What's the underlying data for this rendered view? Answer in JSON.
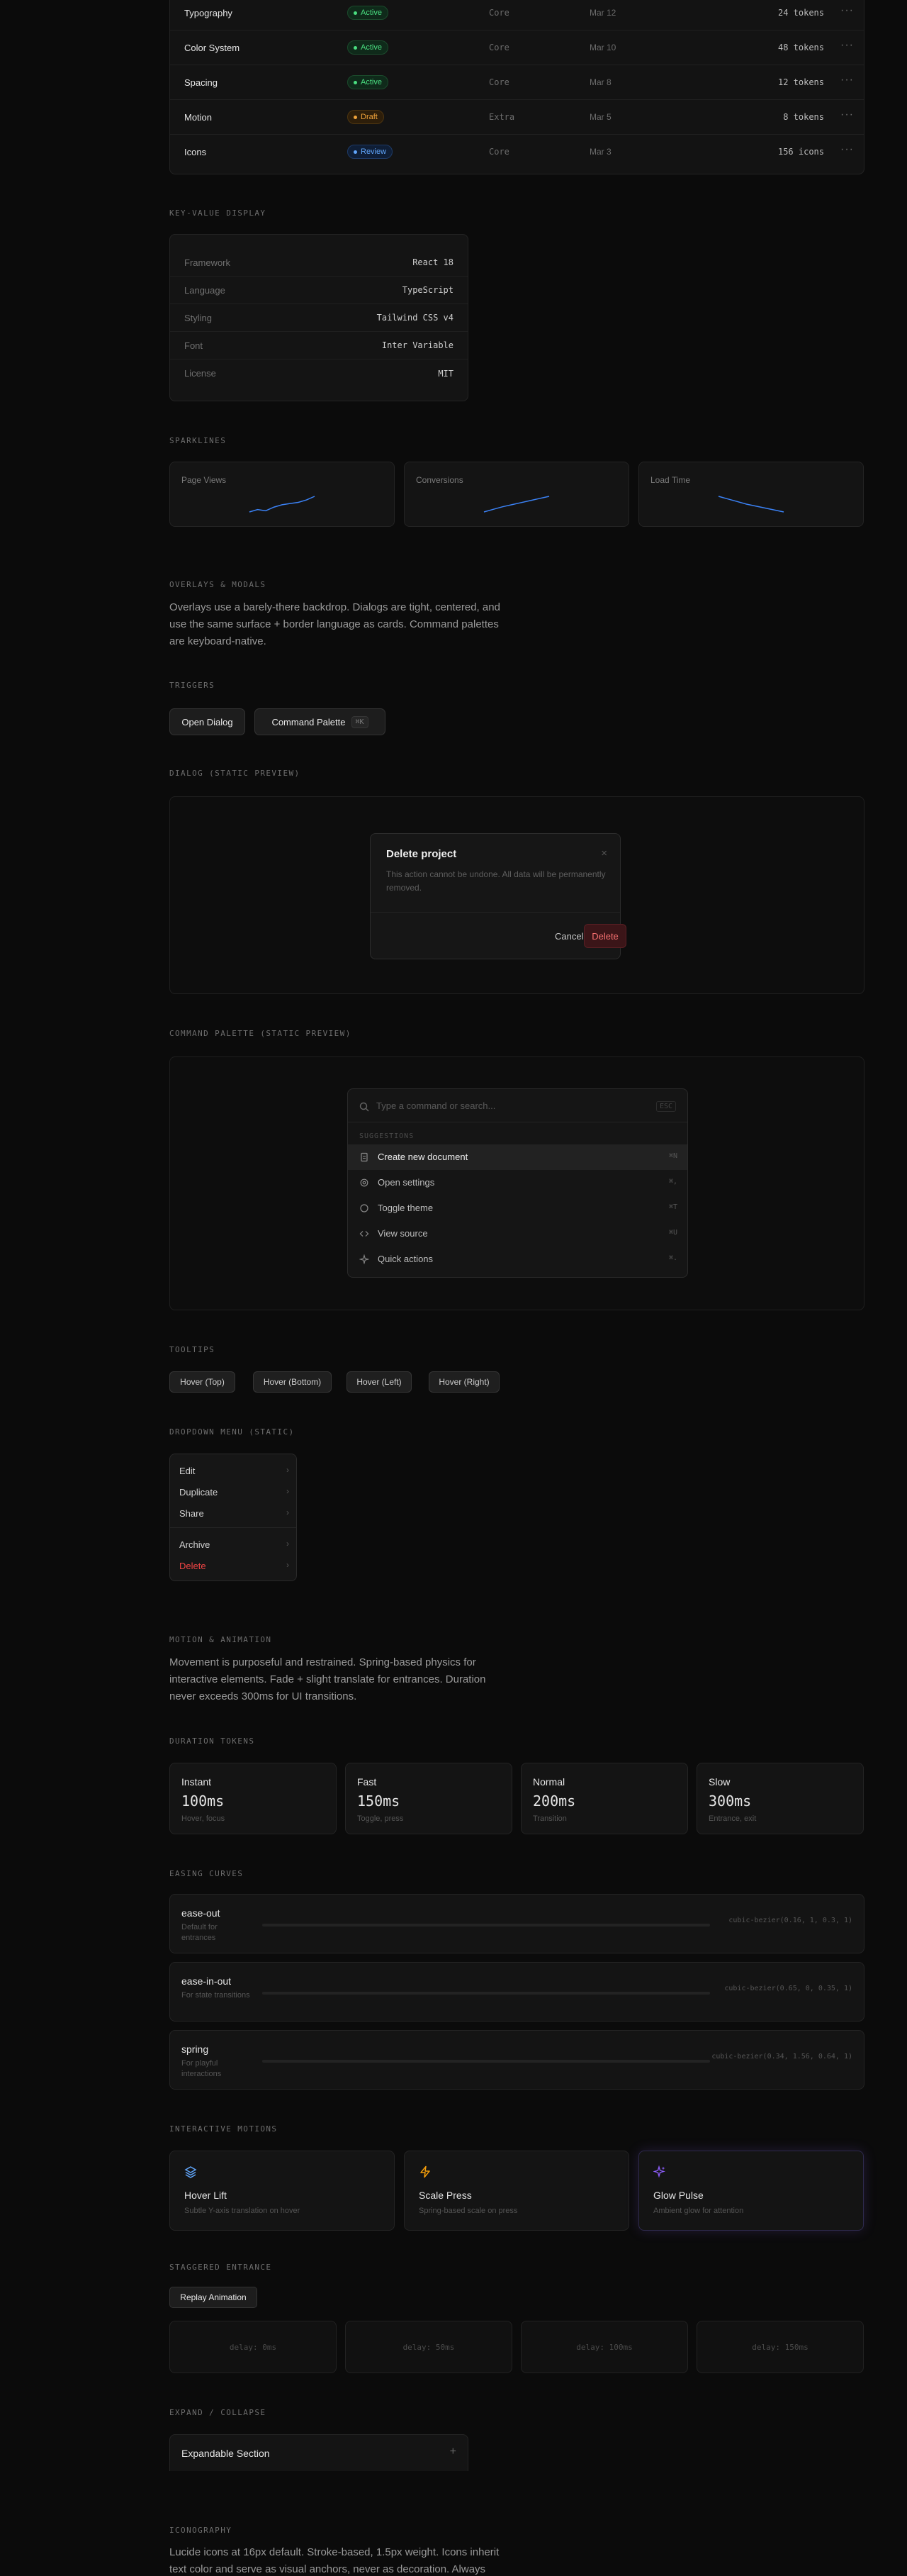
{
  "table": {
    "rows": [
      {
        "name": "Typography",
        "status": "Active",
        "category": "Core",
        "date": "Mar 12",
        "count": "24 tokens"
      },
      {
        "name": "Color System",
        "status": "Active",
        "category": "Core",
        "date": "Mar 10",
        "count": "48 tokens"
      },
      {
        "name": "Spacing",
        "status": "Active",
        "category": "Core",
        "date": "Mar 8",
        "count": "12 tokens"
      },
      {
        "name": "Motion",
        "status": "Draft",
        "category": "Extra",
        "date": "Mar 5",
        "count": "8 tokens"
      },
      {
        "name": "Icons",
        "status": "Review",
        "category": "Core",
        "date": "Mar 3",
        "count": "156 icons"
      }
    ],
    "more_glyph": "···"
  },
  "kv": {
    "label": "KEY-VALUE DISPLAY",
    "rows": [
      {
        "key": "Framework",
        "value": "React 18"
      },
      {
        "key": "Language",
        "value": "TypeScript"
      },
      {
        "key": "Styling",
        "value": "Tailwind CSS v4"
      },
      {
        "key": "Font",
        "value": "Inter Variable"
      },
      {
        "key": "License",
        "value": "MIT"
      }
    ]
  },
  "sparklines": {
    "label": "SPARKLINES",
    "items": [
      {
        "name": "Page Views",
        "color": "#3b82f6",
        "values": [
          2,
          3,
          2.5,
          4,
          5,
          5.5,
          6,
          7,
          8.5
        ]
      },
      {
        "name": "Conversions",
        "color": "#3b82f6",
        "values": [
          2,
          2.5,
          3,
          3.4,
          3.8,
          4.2,
          4.6,
          5
        ]
      },
      {
        "name": "Load Time",
        "color": "#3b82f6",
        "values": [
          6,
          5.6,
          5.2,
          4.8,
          4.5,
          4.2,
          3.9,
          3.6
        ]
      }
    ]
  },
  "overlays": {
    "title": "OVERLAYS & MODALS",
    "desc": "Overlays use a barely-there backdrop. Dialogs are tight, centered, and use the same surface + border language as cards. Command palettes are keyboard-native.",
    "triggers_label": "TRIGGERS",
    "open_dialog": "Open Dialog",
    "command_palette": "Command Palette",
    "palette_kbd": "⌘K",
    "dialog_label": "DIALOG (STATIC PREVIEW)",
    "dialog": {
      "title": "Delete project",
      "body": "This action cannot be undone. All data will be permanently removed.",
      "close": "×",
      "cancel": "Cancel",
      "delete": "Delete"
    },
    "palette_label": "COMMAND PALETTE (STATIC PREVIEW)",
    "palette": {
      "placeholder": "Type a command or search...",
      "esc": "ESC",
      "group": "SUGGESTIONS",
      "items": [
        {
          "label": "Create new document",
          "icon": "file-icon",
          "kbd": "⌘N"
        },
        {
          "label": "Open settings",
          "icon": "gear-icon",
          "kbd": "⌘,"
        },
        {
          "label": "Toggle theme",
          "icon": "sun-icon",
          "kbd": "⌘T"
        },
        {
          "label": "View source",
          "icon": "code-icon",
          "kbd": "⌘U"
        },
        {
          "label": "Quick actions",
          "icon": "sparkle-icon",
          "kbd": "⌘."
        }
      ]
    }
  },
  "tooltips": {
    "label": "TOOLTIPS",
    "buttons": [
      "Hover (Top)",
      "Hover (Bottom)",
      "Hover (Left)",
      "Hover (Right)"
    ]
  },
  "dropdown": {
    "label": "DROPDOWN MENU (STATIC)",
    "items": [
      "Edit",
      "Duplicate",
      "Share",
      "Archive",
      "Delete"
    ],
    "chevron": "›"
  },
  "motion": {
    "title": "MOTION & ANIMATION",
    "desc": "Movement is purposeful and restrained. Spring-based physics for interactive elements. Fade + slight translate for entrances. Duration never exceeds 300ms for UI transitions.",
    "duration_label": "DURATION TOKENS",
    "durations": [
      {
        "name": "Instant",
        "value": "100ms",
        "desc": "Hover, focus"
      },
      {
        "name": "Fast",
        "value": "150ms",
        "desc": "Toggle, press"
      },
      {
        "name": "Normal",
        "value": "200ms",
        "desc": "Transition"
      },
      {
        "name": "Slow",
        "value": "300ms",
        "desc": "Entrance, exit"
      }
    ],
    "easing_label": "EASING CURVES",
    "easings": [
      {
        "name": "ease-out",
        "desc": "Default for entrances",
        "fn": "cubic-bezier(0.16, 1, 0.3, 1)"
      },
      {
        "name": "ease-in-out",
        "desc": "For state transitions",
        "fn": "cubic-bezier(0.65, 0, 0.35, 1)"
      },
      {
        "name": "spring",
        "desc": "For playful interactions",
        "fn": "cubic-bezier(0.34, 1.56, 0.64, 1)"
      }
    ],
    "interactive_label": "INTERACTIVE MOTIONS",
    "interactive": [
      {
        "name": "Hover Lift",
        "desc": "Subtle Y-axis translation on hover",
        "icon": "layers-icon",
        "color": "#60a5fa"
      },
      {
        "name": "Scale Press",
        "desc": "Spring-based scale on press",
        "icon": "zap-icon",
        "color": "#f59e0b"
      },
      {
        "name": "Glow Pulse",
        "desc": "Ambient glow for attention",
        "icon": "sparkles-icon",
        "color": "#8b5cf6"
      }
    ],
    "stagger_label": "STAGGERED ENTRANCE",
    "replay": "Replay Animation",
    "delays": [
      "delay: 0ms",
      "delay: 50ms",
      "delay: 100ms",
      "delay: 150ms"
    ],
    "expand_label": "EXPAND / COLLAPSE",
    "expand_title": "Expandable Section",
    "expand_icon": "+"
  },
  "iconography": {
    "title": "ICONOGRAPHY",
    "desc": "Lucide icons at 16px default. Stroke-based, 1.5px weight. Icons inherit text color and serve as visual anchors, never as decoration. Always"
  },
  "colors": {
    "accent": "#3b82f6",
    "danger": "#ef4444",
    "bg": "#0b0b0b",
    "surface": "#141414"
  }
}
